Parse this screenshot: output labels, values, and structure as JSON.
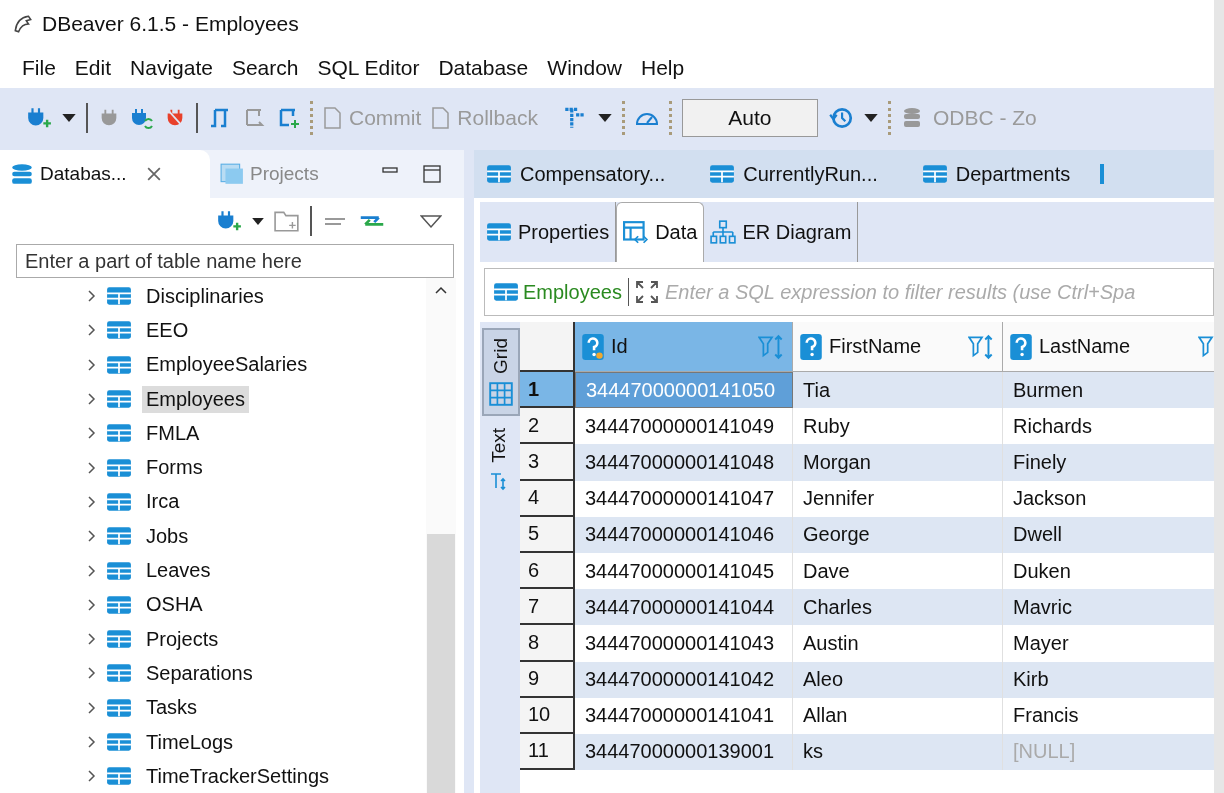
{
  "window": {
    "title": "DBeaver 6.1.5 - Employees"
  },
  "menu": [
    "File",
    "Edit",
    "Navigate",
    "Search",
    "SQL Editor",
    "Database",
    "Window",
    "Help"
  ],
  "toolbar": {
    "commit": {
      "label": "Commit",
      "disabled": true
    },
    "rollback": {
      "label": "Rollback",
      "disabled": true
    },
    "mode": "Auto",
    "datasource": {
      "label": "ODBC - Zo",
      "disabled": true
    }
  },
  "left_panel": {
    "tabs": [
      {
        "label": "Databas...",
        "selected": true
      },
      {
        "label": "Projects",
        "selected": false
      }
    ],
    "search": {
      "placeholder": "Enter a part of table name here"
    },
    "tree": [
      {
        "label": "Disciplinaries",
        "expanded": false,
        "selected": false
      },
      {
        "label": "EEO",
        "expanded": false,
        "selected": false
      },
      {
        "label": "EmployeeSalaries",
        "expanded": false,
        "selected": false
      },
      {
        "label": "Employees",
        "expanded": false,
        "selected": true
      },
      {
        "label": "FMLA",
        "expanded": false,
        "selected": false
      },
      {
        "label": "Forms",
        "expanded": false,
        "selected": false
      },
      {
        "label": "Irca",
        "expanded": false,
        "selected": false
      },
      {
        "label": "Jobs",
        "expanded": false,
        "selected": false
      },
      {
        "label": "Leaves",
        "expanded": false,
        "selected": false
      },
      {
        "label": "OSHA",
        "expanded": false,
        "selected": false
      },
      {
        "label": "Projects",
        "expanded": false,
        "selected": false
      },
      {
        "label": "Separations",
        "expanded": false,
        "selected": false
      },
      {
        "label": "Tasks",
        "expanded": false,
        "selected": false
      },
      {
        "label": "TimeLogs",
        "expanded": false,
        "selected": false
      },
      {
        "label": "TimeTrackerSettings",
        "expanded": false,
        "selected": false
      }
    ]
  },
  "editor_tabs": [
    {
      "label": "Compensatory..."
    },
    {
      "label": "CurrentlyRun..."
    },
    {
      "label": "Departments"
    }
  ],
  "sub_tabs": [
    {
      "label": "Properties",
      "selected": false,
      "kind": "table"
    },
    {
      "label": "Data",
      "selected": true,
      "kind": "data"
    },
    {
      "label": "ER Diagram",
      "selected": false,
      "kind": "diagram"
    }
  ],
  "filter": {
    "entity": "Employees",
    "placeholder": "Enter a SQL expression to filter results (use Ctrl+Spa"
  },
  "view_tabs": [
    {
      "label": "Grid",
      "selected": true,
      "kind": "grid"
    },
    {
      "label": "Text",
      "selected": false,
      "kind": "text"
    }
  ],
  "table": {
    "columns": [
      {
        "label": "Id",
        "selected": true
      },
      {
        "label": "FirstName",
        "selected": false
      },
      {
        "label": "LastName",
        "selected": false
      }
    ],
    "rows": [
      {
        "number": "1",
        "id": "34447000000141050",
        "first_name": "Tia",
        "last_name": "Burmen",
        "last_name_null": false,
        "selected": true
      },
      {
        "number": "2",
        "id": "34447000000141049",
        "first_name": "Ruby",
        "last_name": "Richards",
        "last_name_null": false,
        "selected": false
      },
      {
        "number": "3",
        "id": "34447000000141048",
        "first_name": "Morgan",
        "last_name": "Finely",
        "last_name_null": false,
        "selected": false
      },
      {
        "number": "4",
        "id": "34447000000141047",
        "first_name": "Jennifer",
        "last_name": "Jackson",
        "last_name_null": false,
        "selected": false
      },
      {
        "number": "5",
        "id": "34447000000141046",
        "first_name": "George",
        "last_name": "Dwell",
        "last_name_null": false,
        "selected": false
      },
      {
        "number": "6",
        "id": "34447000000141045",
        "first_name": "Dave",
        "last_name": "Duken",
        "last_name_null": false,
        "selected": false
      },
      {
        "number": "7",
        "id": "34447000000141044",
        "first_name": "Charles",
        "last_name": "Mavric",
        "last_name_null": false,
        "selected": false
      },
      {
        "number": "8",
        "id": "34447000000141043",
        "first_name": "Austin",
        "last_name": "Mayer",
        "last_name_null": false,
        "selected": false
      },
      {
        "number": "9",
        "id": "34447000000141042",
        "first_name": "Aleo",
        "last_name": "Kirb",
        "last_name_null": false,
        "selected": false
      },
      {
        "number": "10",
        "id": "34447000000141041",
        "first_name": "Allan",
        "last_name": "Francis",
        "last_name_null": false,
        "selected": false
      },
      {
        "number": "11",
        "id": "34447000000139001",
        "first_name": "ks",
        "last_name": "[NULL]",
        "last_name_null": true,
        "selected": false
      }
    ]
  }
}
